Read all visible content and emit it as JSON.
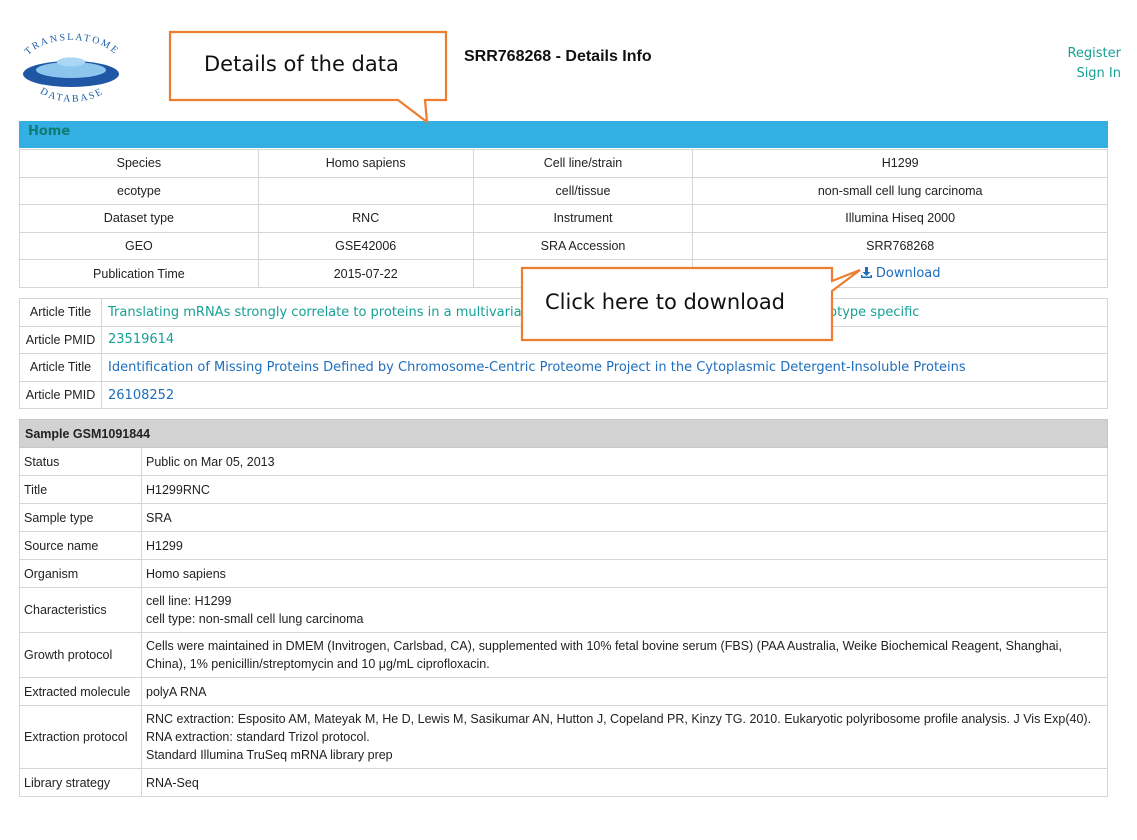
{
  "header": {
    "logo_text_top": "TRANSLATOME",
    "logo_text_bottom": "DATABASE",
    "title": "SRR768268 - Details Info",
    "register": "Register",
    "sign_in": "Sign In"
  },
  "nav": {
    "home": "Home"
  },
  "info_table": [
    [
      "Species",
      "Homo sapiens",
      "Cell line/strain",
      "H1299"
    ],
    [
      "ecotype",
      "",
      "cell/tissue",
      "non-small cell lung carcinoma"
    ],
    [
      "Dataset type",
      "RNC",
      "Instrument",
      "Illumina Hiseq 2000"
    ],
    [
      "GEO",
      "GSE42006",
      "SRA Accession",
      "SRR768268"
    ],
    [
      "Publication Time",
      "2015-07-22",
      "",
      ""
    ]
  ],
  "download_label": "Download",
  "articles": [
    {
      "label": "Article Title",
      "value": "Translating mRNAs strongly correlate to proteins in a multivariate manner and their translation ratios are phenotype specific",
      "color": "teal"
    },
    {
      "label": "Article PMID",
      "value": "23519614",
      "color": "teal"
    },
    {
      "label": "Article Title",
      "value": "Identification of Missing Proteins Defined by Chromosome-Centric Proteome Project in the Cytoplasmic Detergent-Insoluble Proteins",
      "color": "blue"
    },
    {
      "label": "Article PMID",
      "value": "26108252",
      "color": "blue"
    }
  ],
  "sample": {
    "header": "Sample GSM1091844",
    "rows": [
      {
        "key": "Status",
        "lines": [
          "Public on Mar 05, 2013"
        ]
      },
      {
        "key": "Title",
        "lines": [
          "H1299RNC"
        ]
      },
      {
        "key": "Sample type",
        "lines": [
          "SRA"
        ]
      },
      {
        "key": "Source name",
        "lines": [
          "H1299"
        ]
      },
      {
        "key": "Organism",
        "lines": [
          "Homo sapiens"
        ]
      },
      {
        "key": "Characteristics",
        "lines": [
          "cell line: H1299",
          "cell type: non-small cell lung carcinoma"
        ]
      },
      {
        "key": "Growth protocol",
        "lines": [
          "Cells were maintained in DMEM (Invitrogen, Carlsbad, CA), supplemented with 10% fetal bovine serum (FBS) (PAA Australia, Weike Biochemical Reagent, Shanghai, China), 1% penicillin/streptomycin and 10 μg/mL ciprofloxacin."
        ]
      },
      {
        "key": "Extracted molecule",
        "lines": [
          "polyA RNA"
        ]
      },
      {
        "key": "Extraction protocol",
        "lines": [
          "RNC extraction: Esposito AM, Mateyak M, He D, Lewis M, Sasikumar AN, Hutton J, Copeland PR, Kinzy TG. 2010. Eukaryotic polyribosome profile analysis. J Vis Exp(40). RNA extraction: standard Trizol protocol.",
          "Standard Illumina TruSeq mRNA library prep"
        ]
      },
      {
        "key": "Library strategy",
        "lines": [
          "RNA-Seq"
        ]
      }
    ]
  },
  "callouts": {
    "details": "Details of the data",
    "download": "Click here to download"
  },
  "colors": {
    "navbar": "#33afe4",
    "teal_link": "#17a096",
    "blue_link": "#1e6ebd",
    "callout_border": "#ed7d31"
  }
}
